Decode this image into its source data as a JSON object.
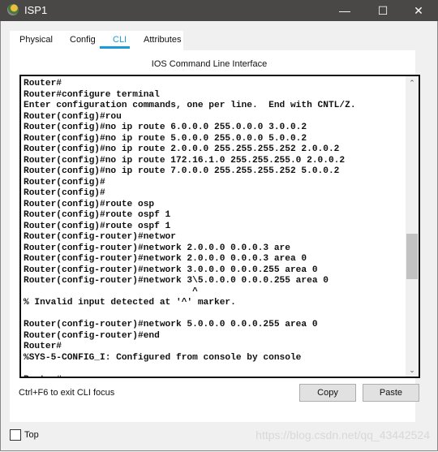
{
  "window": {
    "title": "ISP1",
    "minimize": "—",
    "maximize": "☐",
    "close": "✕"
  },
  "tabs": [
    {
      "label": "Physical"
    },
    {
      "label": "Config"
    },
    {
      "label": "CLI",
      "active": true
    },
    {
      "label": "Attributes"
    }
  ],
  "accent_color": "#1a9ad6",
  "panel_title": "IOS Command Line Interface",
  "terminal_lines": [
    "Router#",
    "Router#configure terminal",
    "Enter configuration commands, one per line.  End with CNTL/Z.",
    "Router(config)#rou",
    "Router(config)#no ip route 6.0.0.0 255.0.0.0 3.0.0.2",
    "Router(config)#no ip route 5.0.0.0 255.0.0.0 5.0.0.2",
    "Router(config)#no ip route 2.0.0.0 255.255.255.252 2.0.0.2",
    "Router(config)#no ip route 172.16.1.0 255.255.255.0 2.0.0.2",
    "Router(config)#no ip route 7.0.0.0 255.255.255.252 5.0.0.2",
    "Router(config)#",
    "Router(config)#",
    "Router(config)#route osp",
    "Router(config)#route ospf 1",
    "Router(config)#route ospf 1",
    "Router(config-router)#networ",
    "Router(config-router)#network 2.0.0.0 0.0.0.3 are",
    "Router(config-router)#network 2.0.0.0 0.0.0.3 area 0",
    "Router(config-router)#network 3.0.0.0 0.0.0.255 area 0",
    "Router(config-router)#network 3\\5.0.0.0 0.0.0.255 area 0",
    "                               ^",
    "% Invalid input detected at '^' marker.",
    "",
    "Router(config-router)#network 5.0.0.0 0.0.0.255 area 0",
    "Router(config-router)#end",
    "Router#",
    "%SYS-5-CONFIG_I: Configured from console by console",
    "",
    "Router#"
  ],
  "hint": "Ctrl+F6 to exit CLI focus",
  "buttons": {
    "copy": "Copy",
    "paste": "Paste"
  },
  "top_checkbox": {
    "label": "Top",
    "checked": false
  },
  "watermark": "https://blog.csdn.net/qq_43442524"
}
